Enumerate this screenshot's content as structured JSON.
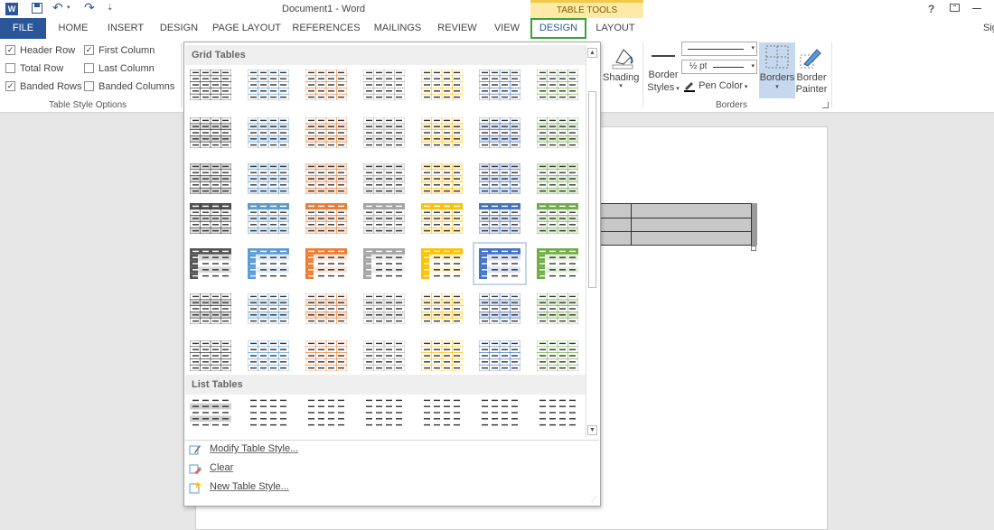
{
  "titlebar": {
    "title": "Document1 - Word",
    "table_tools": "TABLE TOOLS",
    "help": "?",
    "sign_in": "Sig"
  },
  "tabs": [
    "FILE",
    "HOME",
    "INSERT",
    "DESIGN",
    "PAGE LAYOUT",
    "REFERENCES",
    "MAILINGS",
    "REVIEW",
    "VIEW",
    "DESIGN",
    "LAYOUT"
  ],
  "options": {
    "header_row": "Header Row",
    "first_column": "First Column",
    "total_row": "Total Row",
    "last_column": "Last Column",
    "banded_rows": "Banded Rows",
    "banded_columns": "Banded Columns",
    "group_label": "Table Style Options",
    "checked": {
      "header_row": true,
      "first_column": true,
      "total_row": false,
      "last_column": false,
      "banded_rows": true,
      "banded_columns": false
    }
  },
  "borders": {
    "shading": "Shading",
    "border_styles_1": "Border",
    "border_styles_2": "Styles",
    "weight": "½ pt",
    "pen_color": "Pen Color",
    "borders_btn": "Borders",
    "border_painter_1": "Border",
    "border_painter_2": "Painter",
    "group_label": "Borders"
  },
  "gallery": {
    "grid_header": "Grid Tables",
    "list_header": "List Tables",
    "modify": "Modify Table Style...",
    "clear": "Clear",
    "new": "New Table Style...",
    "selected_index": 33,
    "colors": [
      "#555555",
      "#5b9bd5",
      "#ed7d31",
      "#a5a5a5",
      "#ffc000",
      "#4472c4",
      "#70ad47"
    ],
    "tints": [
      "#d9d9d9",
      "#deeaf6",
      "#fbe4d5",
      "#ededed",
      "#fff2cc",
      "#d9e2f3",
      "#e2efd9"
    ]
  },
  "colors": {
    "file_tab": "#2b579a",
    "design_highlight": "#3aa13a",
    "table_tools_bar": "#fdeaa7",
    "borders_active": "#c5d8ee"
  }
}
